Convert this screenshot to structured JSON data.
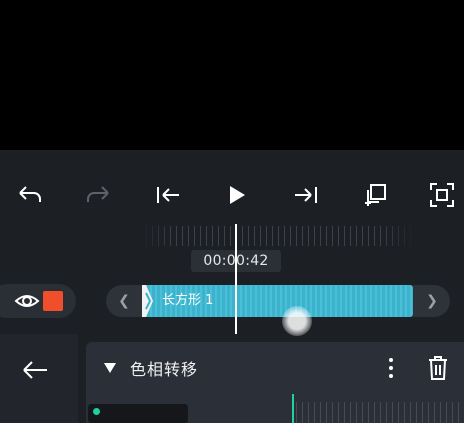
{
  "timeline": {
    "timecode": "00:00:42",
    "clip_label": "长方形 1",
    "clip_color": "#46bcd6",
    "shape_color": "#f14f2c"
  },
  "toolbar": {
    "icons": [
      "undo-icon",
      "redo-icon",
      "jump-to-start-icon",
      "play-icon",
      "jump-to-end-icon",
      "duplicate-icon",
      "fullscreen-icon"
    ]
  },
  "effect_panel": {
    "title": "色相转移",
    "accent_color": "#1fd0a0"
  }
}
